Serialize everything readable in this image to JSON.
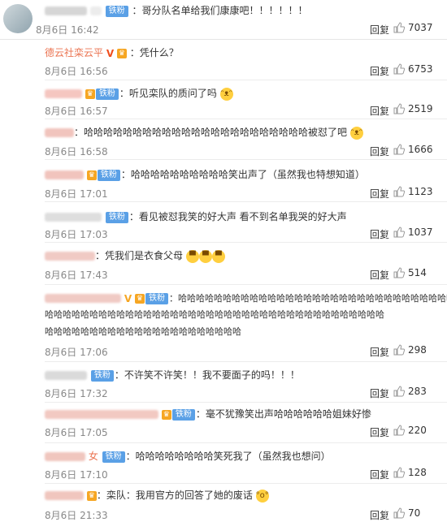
{
  "colors": {
    "badge": "#5aa0e6",
    "name": "#eb7350",
    "like_icon": "#999999"
  },
  "reply_label": "回复",
  "top": {
    "text": "：哥分队名单给我们康康吧！！！！！！",
    "time": "8月6日 16:42",
    "likes": "7037",
    "badge": "铁粉"
  },
  "comments": [
    {
      "name": "德云社栾云平",
      "text": "：凭什么？",
      "time": "8月6日 16:56",
      "likes": "6753"
    },
    {
      "badge": "铁粉",
      "text": "：听见栾队的质问了吗",
      "time": "8月6日 16:57",
      "likes": "2519"
    },
    {
      "text": "：哈哈哈哈哈哈哈哈哈哈哈哈哈哈哈哈哈哈哈哈哈哈哈被怼了吧",
      "time": "8月6日 16:58",
      "likes": "1666"
    },
    {
      "badge": "铁粉",
      "text": "：哈哈哈哈哈哈哈哈哈哈笑出声了（虽然我也特想知道）",
      "time": "8月6日 17:01",
      "likes": "1123"
    },
    {
      "badge": "铁粉",
      "text": "：看见被怼我笑的好大声 看不到名单我哭的好大声",
      "time": "8月6日 17:03",
      "likes": "1037"
    },
    {
      "text": "：凭我们是衣食父母",
      "time": "8月6日 17:43",
      "likes": "514"
    },
    {
      "badge": "铁粉",
      "text": "：哈哈哈哈哈哈哈哈哈哈哈哈哈哈哈哈哈哈哈哈哈哈哈哈哈哈哈哈哈哈哈",
      "text2": "哈哈哈哈哈哈哈哈哈哈哈哈哈哈哈哈哈哈哈哈哈哈哈哈哈哈哈哈哈哈哈哈哈哈哈哈哈哈",
      "text3": "哈哈哈哈哈哈哈哈哈哈哈哈哈哈哈哈哈哈哈哈哈哈",
      "time": "8月6日 17:06",
      "likes": "298"
    },
    {
      "badge": "铁粉",
      "text": "：不许笑不许笑！！我不要面子的吗！！！",
      "time": "8月6日 17:32",
      "likes": "283"
    },
    {
      "badge": "铁粉",
      "text": "：毫不犹豫笑出声哈哈哈哈哈哈姐妹好惨",
      "time": "8月6日 17:05",
      "likes": "220"
    },
    {
      "name_partial": "女",
      "badge": "铁粉",
      "text": "：哈哈哈哈哈哈哈哈笑死我了（虽然我也想问）",
      "time": "8月6日 17:10",
      "likes": "128"
    },
    {
      "text": "：栾队：我用官方的回答了她的废话",
      "time": "8月6日 21:33",
      "likes": "70"
    }
  ]
}
